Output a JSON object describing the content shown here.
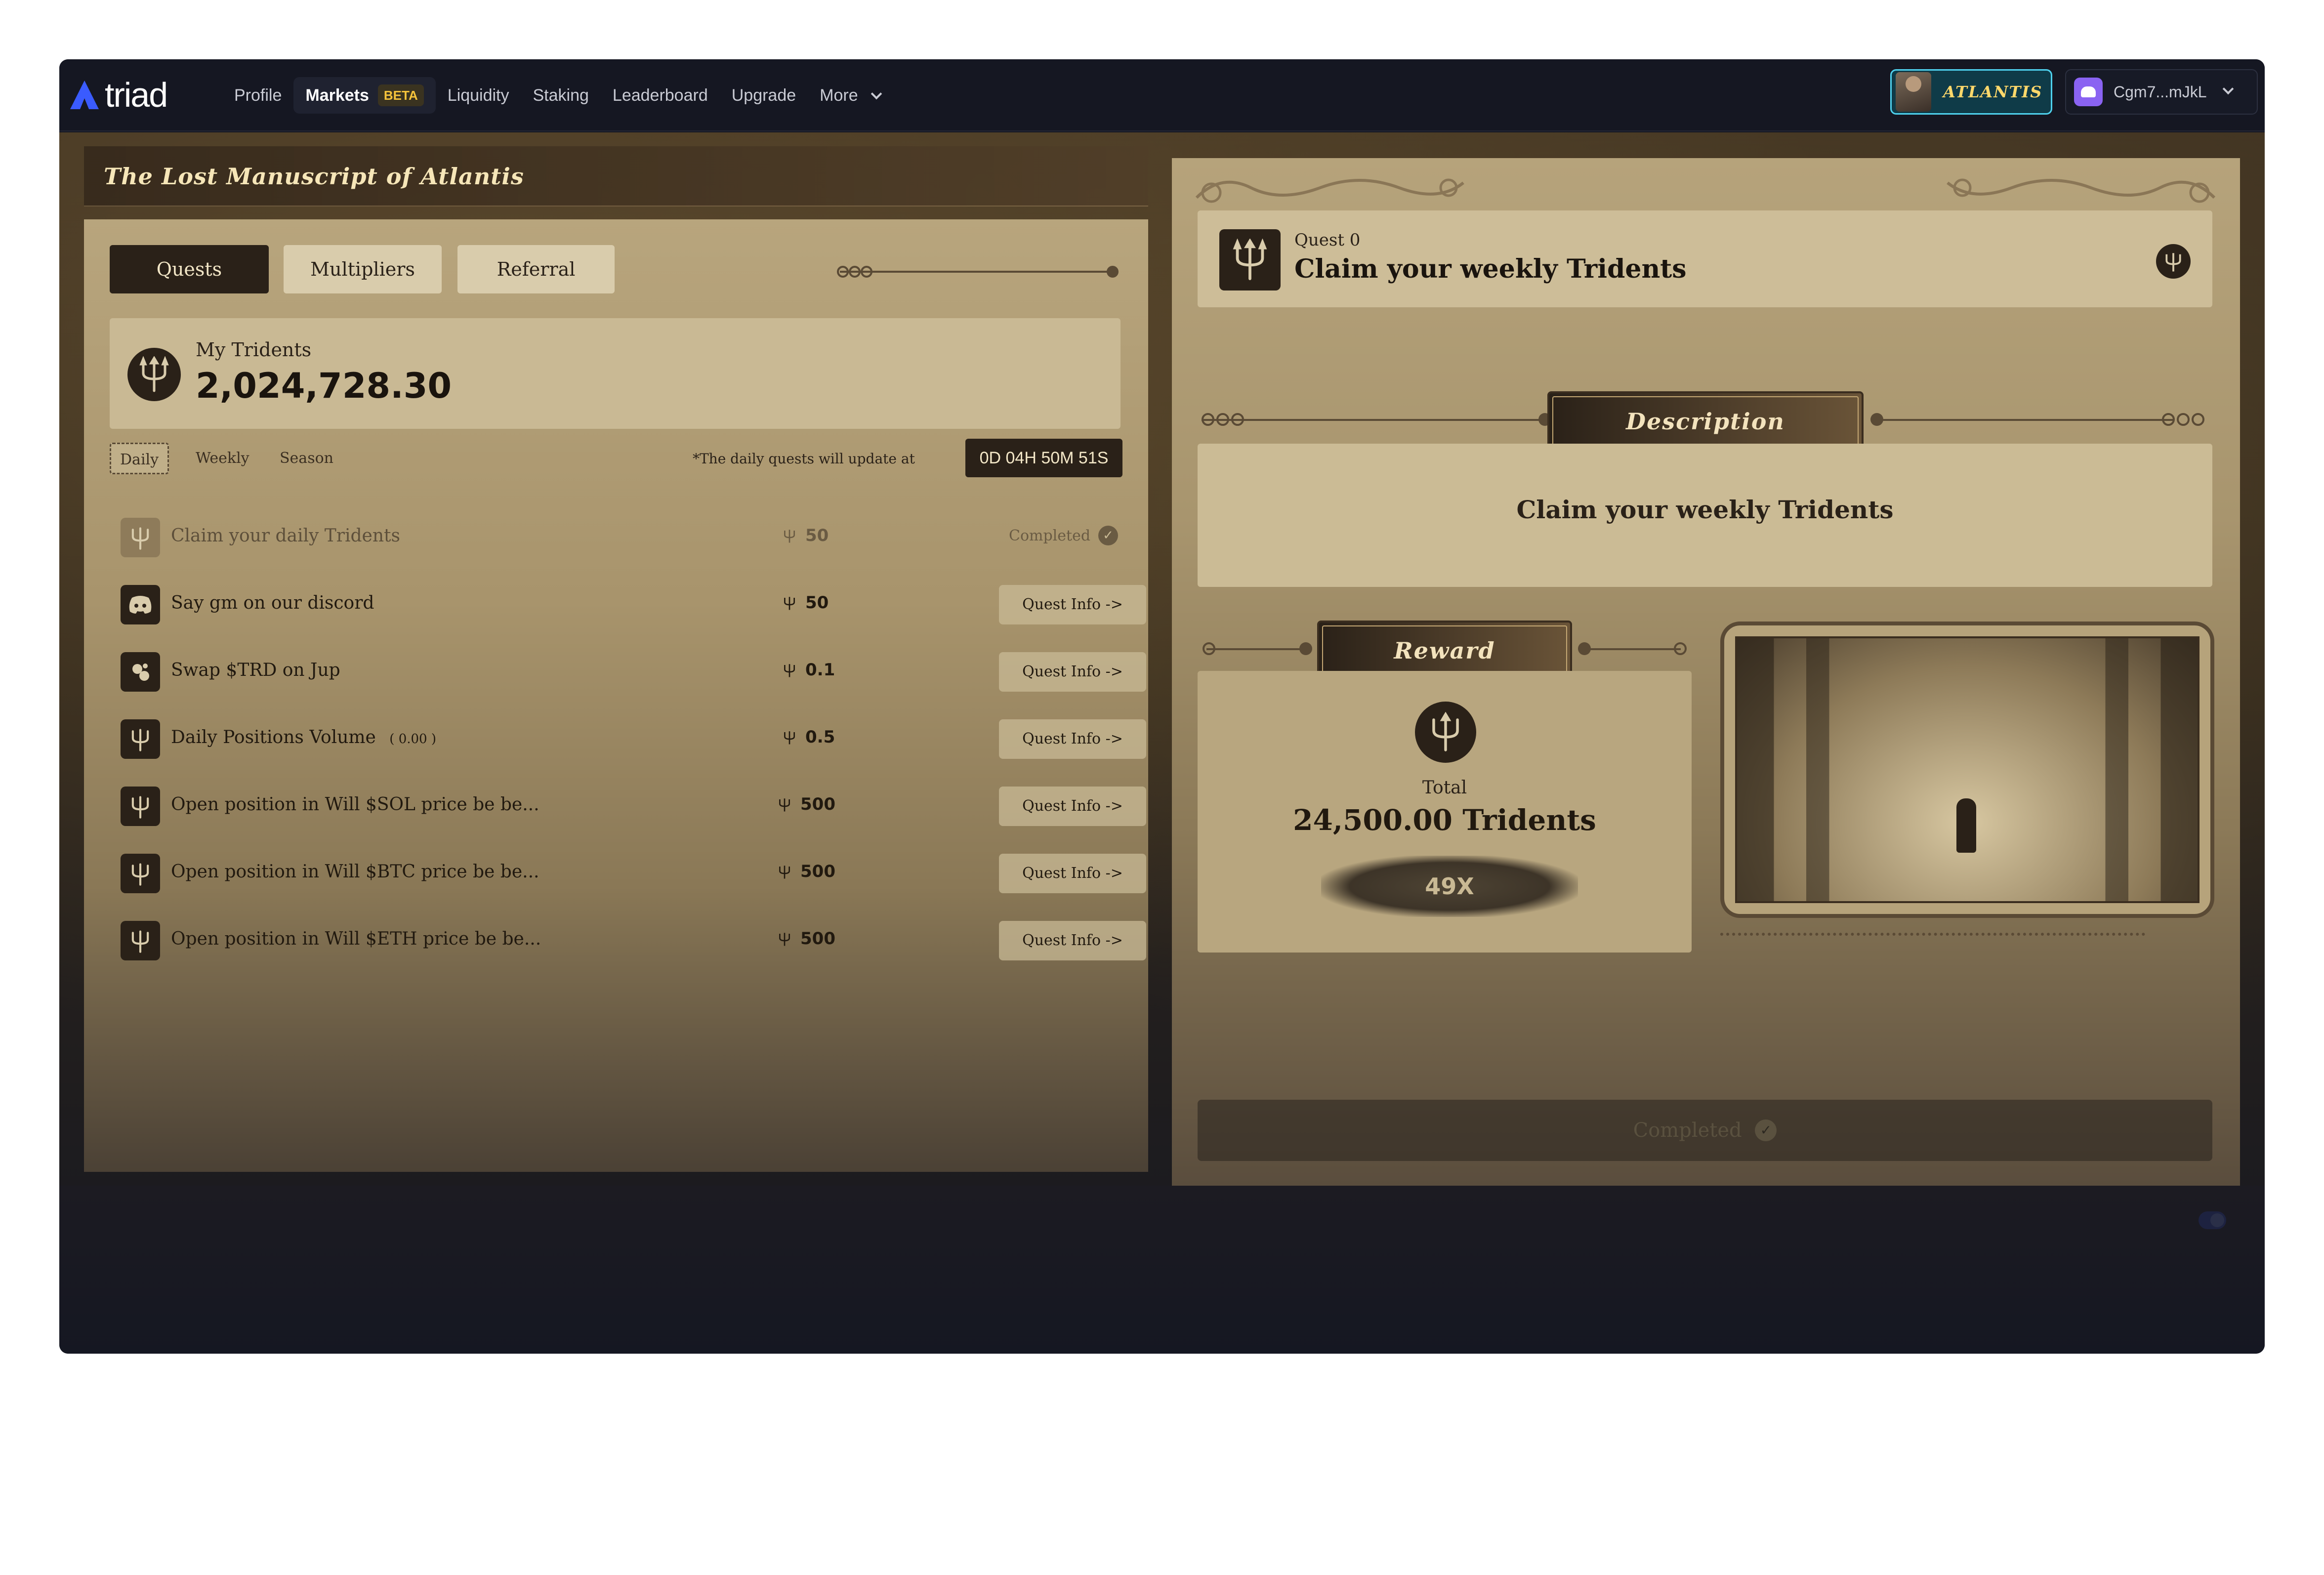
{
  "nav": {
    "brand": "triad",
    "links": [
      {
        "label": "Profile"
      },
      {
        "label": "Markets",
        "badge": "BETA",
        "active": true
      },
      {
        "label": "Liquidity"
      },
      {
        "label": "Staking"
      },
      {
        "label": "Leaderboard"
      },
      {
        "label": "Upgrade"
      },
      {
        "label": "More"
      }
    ],
    "collection_badge": "ATLANTIS",
    "wallet": "Cgm7...mJkL"
  },
  "left": {
    "title": "The Lost Manuscript of Atlantis",
    "tabs": [
      "Quests",
      "Multipliers",
      "Referral"
    ],
    "tridents_label": "My Tridents",
    "tridents_value": "2,024,728.30",
    "periods": [
      "Daily",
      "Weekly",
      "Season"
    ],
    "update_text": "*The daily quests will update at",
    "countdown": "0D 04H 50M 51S",
    "quests": [
      {
        "name": "Claim your daily Tridents",
        "sub": "",
        "points": "50",
        "status": "Completed",
        "done": true,
        "icon": "trident-icon"
      },
      {
        "name": "Say gm on our discord",
        "sub": "",
        "points": "50",
        "action": "Quest Info  ->",
        "icon": "discord-icon"
      },
      {
        "name": "Swap $TRD on Jup",
        "sub": "",
        "points": "0.1",
        "action": "Quest Info  ->",
        "icon": "jupiter-icon"
      },
      {
        "name": "Daily Positions Volume",
        "sub": "( 0.00 )",
        "points": "0.5",
        "action": "Quest Info  ->",
        "icon": "trident-icon"
      },
      {
        "name": "Open position in Will $SOL price be be...",
        "sub": "",
        "points": "500",
        "action": "Quest Info  ->",
        "icon": "trident-icon"
      },
      {
        "name": "Open position in Will $BTC price be be...",
        "sub": "",
        "points": "500",
        "action": "Quest Info  ->",
        "icon": "trident-icon"
      },
      {
        "name": "Open position in Will $ETH price be be...",
        "sub": "",
        "points": "500",
        "action": "Quest Info  ->",
        "icon": "trident-icon"
      }
    ]
  },
  "right": {
    "quest_number": "Quest 0",
    "quest_title": "Claim your weekly Tridents",
    "description_label": "Description",
    "description_text": "Claim your weekly Tridents",
    "reward_label": "Reward",
    "total_label": "Total",
    "total_value": "24,500.00 Tridents",
    "multiplier": "49X",
    "completed_label": "Completed"
  },
  "colors": {
    "accent": "#4fd2ee",
    "beta": "#f5c33b",
    "parchment": "#b8a57d",
    "ink": "#2a2118"
  }
}
